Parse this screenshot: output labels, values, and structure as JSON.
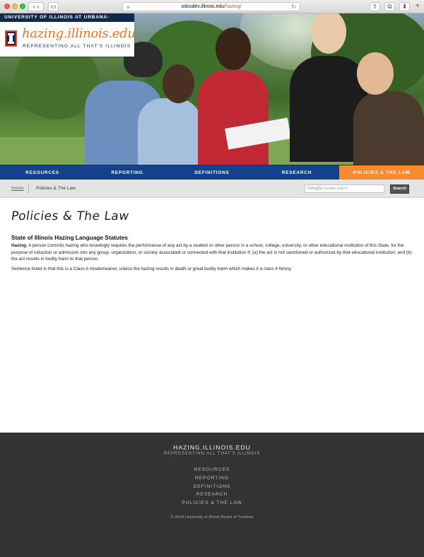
{
  "browser": {
    "url_host": "odosdev.illinois.edu",
    "url_path": "/hazing/"
  },
  "brand": {
    "university": "UNIVERSITY OF ILLINOIS AT URBANA-CHAMPAIGN",
    "site_name": "hazing.illinois.edu",
    "tagline": "REPRESENTING ALL THAT'S ILLINOIS"
  },
  "nav": {
    "items": [
      {
        "label": "RESOURCES"
      },
      {
        "label": "REPORTING"
      },
      {
        "label": "DEFINITIONS"
      },
      {
        "label": "RESEARCH"
      },
      {
        "label": "POLICIES & THE LAW",
        "active": true
      }
    ],
    "active_color": "#f68c2f",
    "bar_color": "#13418a"
  },
  "breadcrumb": {
    "home": "Home",
    "current": "Policies & The Law"
  },
  "search": {
    "google_label": "Google",
    "placeholder": "Custom Search",
    "button": "Search"
  },
  "main": {
    "title": "Policies & The Law",
    "section_heading": "State of Illinois Hazing Language Statutes",
    "paragraph1_lead": "Hazing.",
    "paragraph1_text": " A person commits hazing who knowingly requires the performance of any act by a student or other person in a school, college, university, or other educational institution of this State, for the purpose of induction or admission into any group, organization, or society associated or connected with that institution if; (a) the act is not sanctioned or authorized by that educational institution; and (b) the act results in bodily harm to that person.",
    "paragraph2": "Sentence listed is that this is a Class A misdemeanor, unless the hazing results in death or great bodily harm which makes it a class 4 felony."
  },
  "footer": {
    "title": "HAZING.ILLINOIS.EDU",
    "tagline": "REPRESENTING ALL THAT'S ILLINOIS",
    "links": [
      "RESOURCES",
      "REPORTING",
      "DEFINITIONS",
      "RESEARCH",
      "POLICIES & THE LAW"
    ],
    "copyright": "© 2014 University of Illinois Board of Trustees"
  }
}
